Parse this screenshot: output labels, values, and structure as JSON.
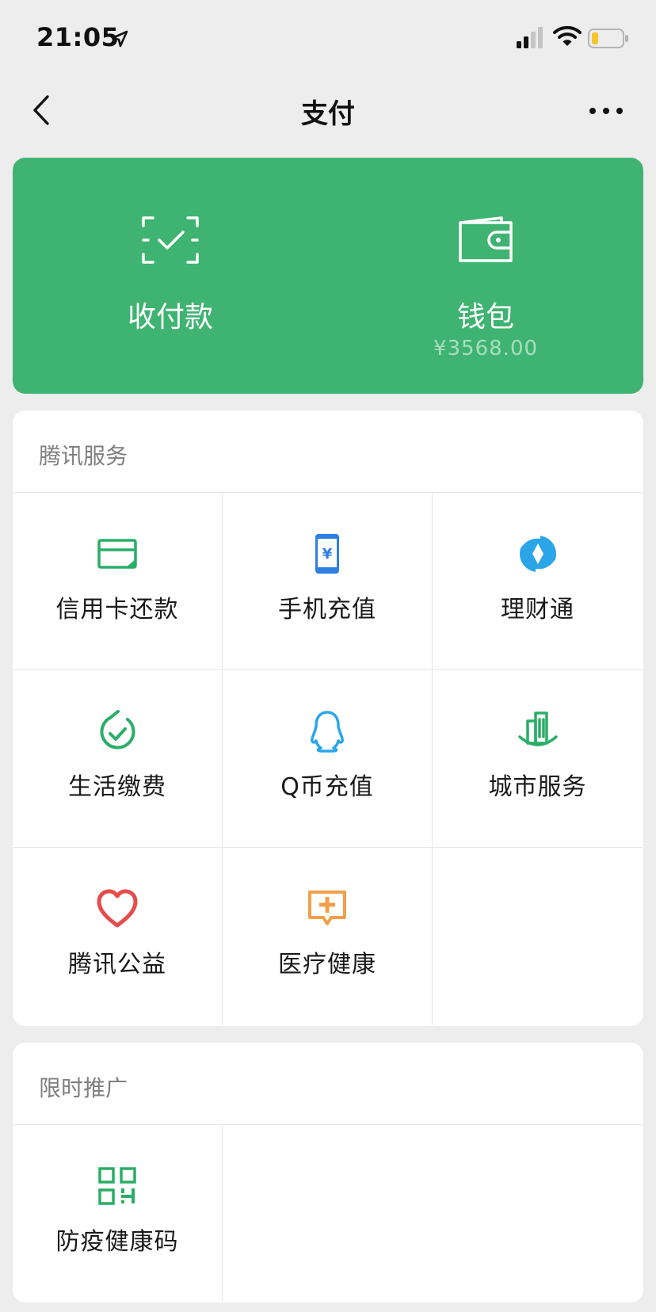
{
  "status": {
    "time": "21:05"
  },
  "nav": {
    "title": "支付"
  },
  "green_card": {
    "pay_label": "收付款",
    "wallet_label": "钱包",
    "wallet_balance": "¥3568.00"
  },
  "tencent_services": {
    "title": "腾讯服务",
    "items": [
      {
        "label": "信用卡还款",
        "icon": "credit-card-icon"
      },
      {
        "label": "手机充值",
        "icon": "phone-topup-icon"
      },
      {
        "label": "理财通",
        "icon": "wealth-icon"
      },
      {
        "label": "生活缴费",
        "icon": "utilities-icon"
      },
      {
        "label": "Q币充值",
        "icon": "qq-penguin-icon"
      },
      {
        "label": "城市服务",
        "icon": "city-icon"
      },
      {
        "label": "腾讯公益",
        "icon": "charity-heart-icon"
      },
      {
        "label": "医疗健康",
        "icon": "medical-icon"
      }
    ]
  },
  "promotion": {
    "title": "限时推广",
    "items": [
      {
        "label": "防疫健康码",
        "icon": "qr-code-icon"
      }
    ]
  },
  "colors": {
    "brand_green": "#3fb371",
    "background": "#ededed",
    "icon_green": "#2aae67",
    "icon_blue": "#2f7fe0",
    "icon_cyan": "#2aa6e8",
    "icon_red": "#e64c4c",
    "icon_orange": "#f0a04b"
  }
}
